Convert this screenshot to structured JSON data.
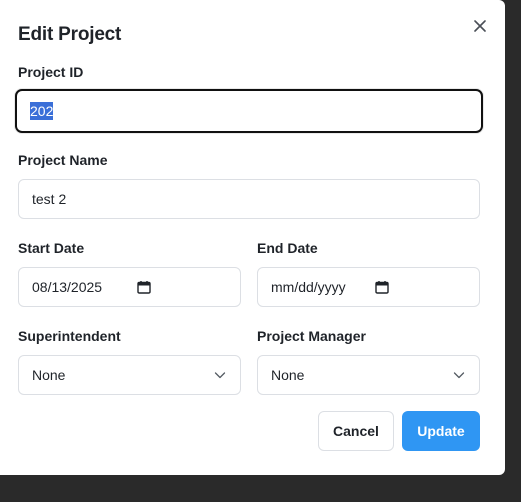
{
  "dialog": {
    "title": "Edit Project",
    "close_icon": "close-icon"
  },
  "fields": {
    "project_id": {
      "label": "Project ID",
      "value": "202"
    },
    "project_name": {
      "label": "Project Name",
      "value": "test 2"
    },
    "start_date": {
      "label": "Start Date",
      "value": "08/13/2025"
    },
    "end_date": {
      "label": "End Date",
      "value": "mm/dd/yyyy"
    },
    "superintendent": {
      "label": "Superintendent",
      "value": "None"
    },
    "project_manager": {
      "label": "Project Manager",
      "value": "None"
    }
  },
  "actions": {
    "cancel": "Cancel",
    "update": "Update"
  },
  "colors": {
    "accent": "#2f96f3",
    "selection": "#3a6fd8",
    "backdrop": "#2a2a2a"
  }
}
